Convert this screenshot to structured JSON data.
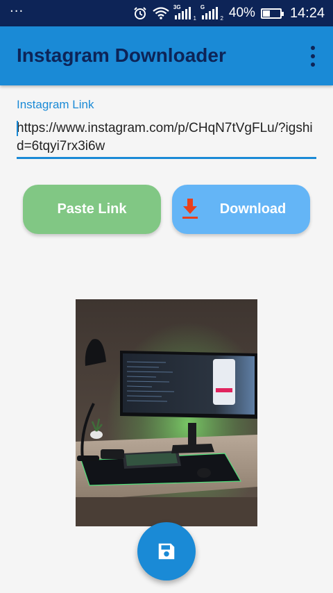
{
  "status_bar": {
    "overflow_indicator": "···",
    "signal1_label": "3G",
    "signal1_sub": "1",
    "signal2_label": "G",
    "signal2_sub": "2",
    "battery_percent": "40%",
    "battery_level": 0.4,
    "time": "14:24",
    "background_color": "#0d2457"
  },
  "app_bar": {
    "title": "Instagram Downloader",
    "menu_icon": "more-vert-icon",
    "background_color": "#1a8ad6",
    "title_color": "#0d2457"
  },
  "link_field": {
    "label": "Instagram Link",
    "value": "https://www.instagram.com/p/CHqN7tVgFLu/?igshid=6tqyi7rx3i6w",
    "accent_color": "#1a8ad6"
  },
  "buttons": {
    "paste_label": "Paste Link",
    "paste_color": "#81c784",
    "download_label": "Download",
    "download_icon": "download-icon",
    "download_color": "#64b5f6",
    "download_icon_color": "#e8401c"
  },
  "preview": {
    "image_icon": "desk-setup-photo"
  },
  "fab": {
    "icon": "save-icon",
    "color": "#1a8ad6"
  }
}
